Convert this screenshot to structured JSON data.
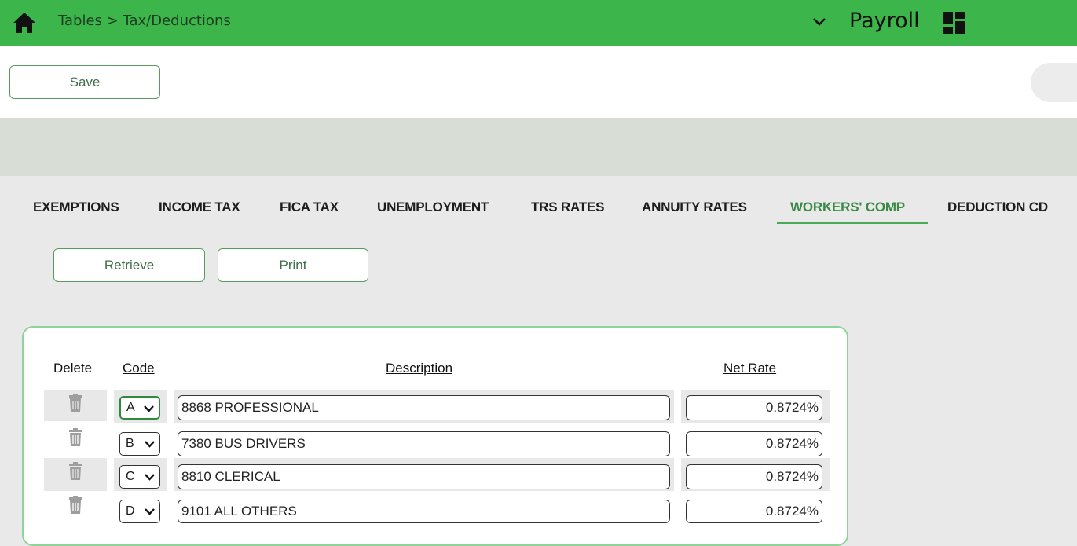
{
  "header": {
    "breadcrumb": "Tables > Tax/Deductions",
    "app_name": "Payroll",
    "icons": [
      "home-icon",
      "chevron-down-icon",
      "app-grid-icon"
    ]
  },
  "toolbar": {
    "save_label": "Save"
  },
  "tabs": [
    {
      "label": "EXEMPTIONS",
      "active": false
    },
    {
      "label": "INCOME TAX",
      "active": false
    },
    {
      "label": "FICA TAX",
      "active": false
    },
    {
      "label": "UNEMPLOYMENT",
      "active": false
    },
    {
      "label": "TRS RATES",
      "active": false
    },
    {
      "label": "ANNUITY RATES",
      "active": false
    },
    {
      "label": "WORKERS' COMP",
      "active": true
    },
    {
      "label": "DEDUCTION CD",
      "active": false
    }
  ],
  "actions": {
    "retrieve_label": "Retrieve",
    "print_label": "Print"
  },
  "table": {
    "columns": {
      "delete": "Delete",
      "code": "Code",
      "description": "Description",
      "net_rate": "Net Rate"
    },
    "rows": [
      {
        "code": "A",
        "description": "8868 PROFESSIONAL",
        "net_rate": "0.8724%"
      },
      {
        "code": "B",
        "description": "7380 BUS DRIVERS",
        "net_rate": "0.8724%"
      },
      {
        "code": "C",
        "description": "8810 CLERICAL",
        "net_rate": "0.8724%"
      },
      {
        "code": "D",
        "description": "9101 ALL OTHERS",
        "net_rate": "0.8724%"
      }
    ]
  },
  "colors": {
    "header_green": "#3cb54a",
    "accent_green": "#3a8a46",
    "band_grey": "#d8ddd6"
  }
}
